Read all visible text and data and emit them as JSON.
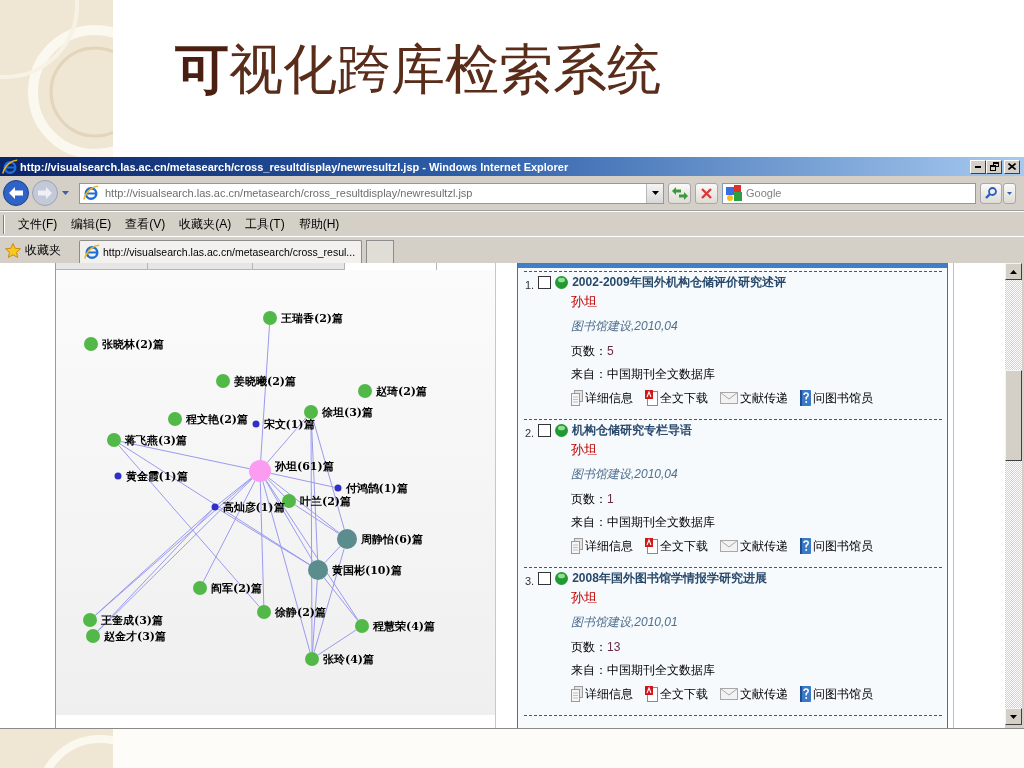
{
  "slide": {
    "title": "**可**视化跨库检索系统"
  },
  "window": {
    "title": "http://visualsearch.las.ac.cn/metasearch/cross_resultdisplay/newresultzl.jsp - Windows Internet Explorer"
  },
  "nav_buttons": [
    {
      "kind": "back",
      "disabled": false
    },
    {
      "kind": "forward",
      "disabled": true
    }
  ],
  "address_bar": {
    "url": "http://visualsearch.las.ac.cn/metasearch/cross_resultdisplay/newresultzl.jsp"
  },
  "search_box": {
    "placeholder": "Google"
  },
  "menu": [
    "文件(F)",
    "编辑(E)",
    "查看(V)",
    "收藏夹(A)",
    "工具(T)",
    "帮助(H)"
  ],
  "favorites_bar": {
    "label": "收藏夹",
    "tabs": [
      {
        "label": "http://visualsearch.las.ac.cn/metasearch/cross_resul...",
        "selected": true
      }
    ]
  },
  "graph": {
    "tabs": [
      {
        "selected": false
      },
      {
        "selected": false
      },
      {
        "selected": false
      },
      {
        "selected": true
      }
    ],
    "nodes": [
      {
        "label": "王瑞香(2)篇",
        "kind": "author",
        "color": "#52b848"
      },
      {
        "label": "张晓林(2)篇",
        "kind": "author",
        "color": "#52b848"
      },
      {
        "label": "姜晓曦(2)篇",
        "kind": "author",
        "color": "#52b848"
      },
      {
        "label": "赵琦(2)篇",
        "kind": "author",
        "color": "#52b848"
      },
      {
        "label": "徐坦(3)篇",
        "kind": "author",
        "color": "#52b848"
      },
      {
        "label": "程文艳(2)篇",
        "kind": "author",
        "color": "#52b848"
      },
      {
        "label": "宋文(1)篇",
        "kind": "minor",
        "color": "#3030c8"
      },
      {
        "label": "蒋飞燕(3)篇",
        "kind": "author",
        "color": "#52b848"
      },
      {
        "label": "孙坦(61)篇",
        "kind": "center",
        "color": "#fb9cf0"
      },
      {
        "label": "黄金霞(1)篇",
        "kind": "minor",
        "color": "#3030c8"
      },
      {
        "label": "付鸿鹄(1)篇",
        "kind": "minor",
        "color": "#3030c8"
      },
      {
        "label": "叶兰(2)篇",
        "kind": "author",
        "color": "#52b848"
      },
      {
        "label": "高灿彦(1)篇",
        "kind": "minor",
        "color": "#3030c8"
      },
      {
        "label": "周静怡(6)篇",
        "kind": "core",
        "color": "#5b8c8e"
      },
      {
        "label": "黄国彬(10)篇",
        "kind": "core",
        "color": "#5b8c8e"
      },
      {
        "label": "阎军(2)篇",
        "kind": "author",
        "color": "#52b848"
      },
      {
        "label": "徐静(2)篇",
        "kind": "author",
        "color": "#52b848"
      },
      {
        "label": "王奎成(3)篇",
        "kind": "author",
        "color": "#52b848"
      },
      {
        "label": "程慧荣(4)篇",
        "kind": "author",
        "color": "#52b848"
      },
      {
        "label": "赵金才(3)篇",
        "kind": "author",
        "color": "#52b848"
      },
      {
        "label": "张玲(4)篇",
        "kind": "author",
        "color": "#52b848"
      }
    ]
  },
  "results": [
    {
      "number": "1.",
      "checked": false,
      "title": "2002-2009年国外机构仓储评价研究述评",
      "author": "孙坦",
      "journal": "图书馆建设,2010,04",
      "pages_label": "页数：",
      "pages": "5",
      "source": "来自：中国期刊全文数据库",
      "actions": [
        {
          "kind": "details",
          "label": "详细信息"
        },
        {
          "kind": "download",
          "label": "全文下载"
        },
        {
          "kind": "delivery",
          "label": "文献传递"
        },
        {
          "kind": "ask",
          "label": "问图书馆员"
        }
      ]
    },
    {
      "number": "2.",
      "checked": false,
      "title": "机构仓储研究专栏导语",
      "author": "孙坦",
      "journal": "图书馆建设,2010,04",
      "pages_label": "页数：",
      "pages": "1",
      "source": "来自：中国期刊全文数据库",
      "actions": [
        {
          "kind": "details",
          "label": "详细信息"
        },
        {
          "kind": "download",
          "label": "全文下载"
        },
        {
          "kind": "delivery",
          "label": "文献传递"
        },
        {
          "kind": "ask",
          "label": "问图书馆员"
        }
      ]
    },
    {
      "number": "3.",
      "checked": false,
      "title": "2008年国外图书馆学情报学研究进展",
      "author": "孙坦",
      "journal": "图书馆建设,2010,01",
      "pages_label": "页数：",
      "pages": "13",
      "source": "来自：中国期刊全文数据库",
      "actions": [
        {
          "kind": "details",
          "label": "详细信息"
        },
        {
          "kind": "download",
          "label": "全文下载"
        },
        {
          "kind": "delivery",
          "label": "文献传递"
        },
        {
          "kind": "ask",
          "label": "问图书馆员"
        }
      ]
    }
  ]
}
